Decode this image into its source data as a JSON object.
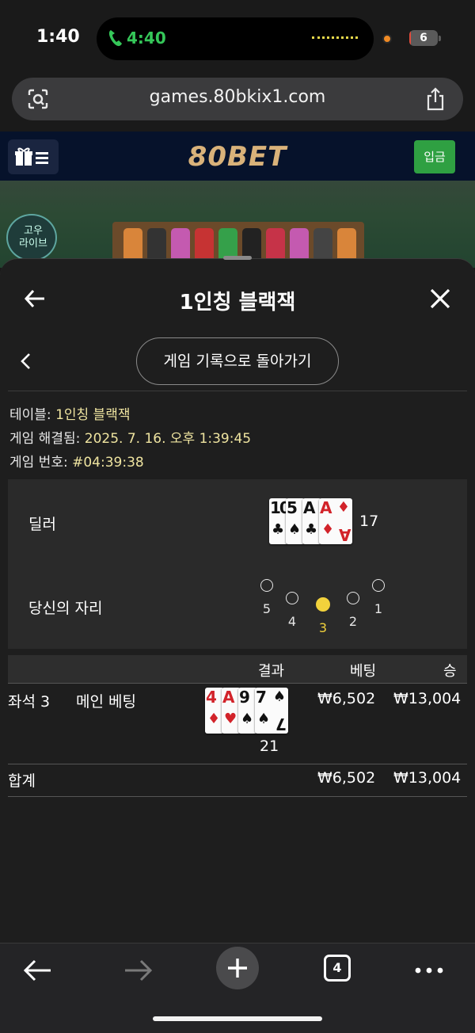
{
  "status_bar": {
    "time": "1:40",
    "call_time": "4:40",
    "battery_level": "6",
    "battery_fraction": 0.06
  },
  "browser": {
    "url": "games.80bkix1.com",
    "tab_count": "4"
  },
  "site": {
    "logo": "80BET",
    "deposit_label": "입금",
    "live_badge": "고우\n라이브"
  },
  "sheet": {
    "title": "1인칭 블랙잭",
    "history_button": "게임 기록으로 돌아가기",
    "info": {
      "table_label": "테이블:",
      "table_value": "1인칭 블랙잭",
      "resolved_label": "게임 해결됨:",
      "resolved_value": "2025. 7. 16. 오후 1:39:45",
      "game_no_label": "게임 번호:",
      "game_no_value": "#04:39:38"
    },
    "dealer": {
      "label": "딜러",
      "cards": [
        {
          "rank": "10",
          "suit": "♣",
          "color": "black"
        },
        {
          "rank": "5",
          "suit": "♠",
          "color": "black"
        },
        {
          "rank": "A",
          "suit": "♣",
          "color": "black"
        },
        {
          "rank": "A",
          "suit": "♦",
          "color": "red"
        }
      ],
      "total": "17"
    },
    "seats": {
      "label": "당신의 자리",
      "numbers": [
        "5",
        "4",
        "3",
        "2",
        "1"
      ],
      "active": "3"
    },
    "table": {
      "headers": {
        "result": "결과",
        "bet": "베팅",
        "win": "승"
      },
      "row": {
        "seat": "좌석 3",
        "bet_type": "메인 베팅",
        "cards": [
          {
            "rank": "4",
            "suit": "♦",
            "color": "red"
          },
          {
            "rank": "A",
            "suit": "♥",
            "color": "red"
          },
          {
            "rank": "9",
            "suit": "♠",
            "color": "black"
          },
          {
            "rank": "7",
            "suit": "♠",
            "color": "black"
          }
        ],
        "total": "21",
        "bet": "₩6,502",
        "win": "₩13,004"
      },
      "sum": {
        "label": "합계",
        "bet": "₩6,502",
        "win": "₩13,004"
      }
    }
  },
  "colors": {
    "accent_yellow": "#f2d23c",
    "deposit_green": "#2fa042",
    "logo_gold": "#d9b27a",
    "call_green": "#35c759"
  }
}
